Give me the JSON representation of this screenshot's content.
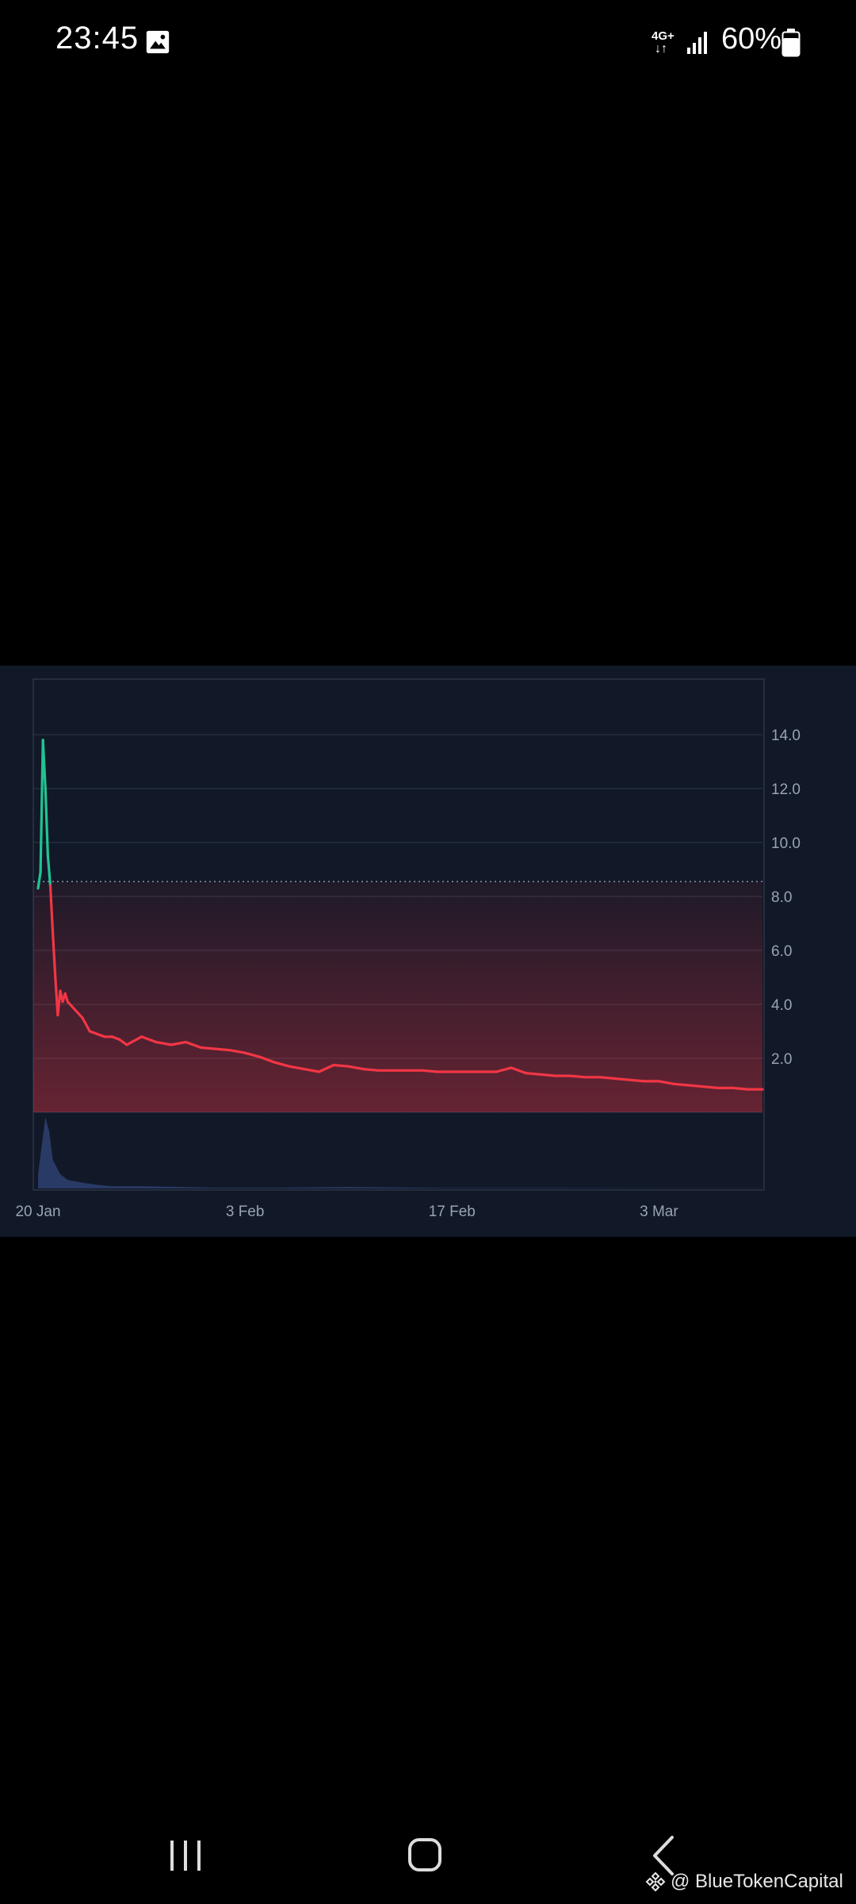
{
  "status_bar": {
    "time": "23:45",
    "network_type": "4G+",
    "battery_percent": "60%",
    "icons": [
      "gallery-icon",
      "signal-icon",
      "battery-icon"
    ]
  },
  "chart_data": {
    "type": "line",
    "x_ticks": [
      "20 Jan",
      "3 Feb",
      "17 Feb",
      "3 Mar"
    ],
    "y_ticks": [
      "14.0",
      "12.0",
      "10.0",
      "8.0",
      "6.0",
      "4.0",
      "2.0"
    ],
    "ylim": [
      0,
      16
    ],
    "reference_line": 8.55,
    "grid": true,
    "colors": {
      "up": "#22c391",
      "down": "#f23645",
      "background": "#111827",
      "grid": "#2a3142",
      "volume": "#2a3a66",
      "axis_text": "#9aa3b2"
    },
    "series": [
      {
        "color": "#f23645",
        "x": [
          "2025-01-20T00:00",
          "2025-01-20T04:00",
          "2025-01-20T08:00",
          "2025-01-20T12:00",
          "2025-01-20T16:00",
          "2025-01-20T20:00",
          "2025-01-21T00:00",
          "2025-01-21T04:00",
          "2025-01-21T08:00",
          "2025-01-21T12:00",
          "2025-01-21T16:00",
          "2025-01-21T20:00",
          "2025-01-22T00:00",
          "2025-01-22T12:00",
          "2025-01-23T00:00",
          "2025-01-23T12:00",
          "2025-01-24T00:00",
          "2025-01-24T12:00",
          "2025-01-25T00:00",
          "2025-01-25T12:00",
          "2025-01-26T00:00",
          "2025-01-27T00:00",
          "2025-01-28T00:00",
          "2025-01-29T00:00",
          "2025-01-30T00:00",
          "2025-01-31T00:00",
          "2025-02-01T00:00",
          "2025-02-02T00:00",
          "2025-02-03T00:00",
          "2025-02-04T00:00",
          "2025-02-05T00:00",
          "2025-02-06T00:00",
          "2025-02-07T00:00",
          "2025-02-08T00:00",
          "2025-02-09T00:00",
          "2025-02-10T00:00",
          "2025-02-11T00:00",
          "2025-02-12T00:00",
          "2025-02-13T00:00",
          "2025-02-14T00:00",
          "2025-02-15T00:00",
          "2025-02-16T00:00",
          "2025-02-17T00:00",
          "2025-02-18T00:00",
          "2025-02-19T00:00",
          "2025-02-20T00:00",
          "2025-02-21T00:00",
          "2025-02-22T00:00",
          "2025-02-23T00:00",
          "2025-02-24T00:00",
          "2025-02-25T00:00",
          "2025-02-26T00:00",
          "2025-02-27T00:00",
          "2025-02-28T00:00",
          "2025-03-01T00:00",
          "2025-03-02T00:00",
          "2025-03-03T00:00",
          "2025-03-04T00:00",
          "2025-03-05T00:00",
          "2025-03-06T00:00",
          "2025-03-07T00:00",
          "2025-03-08T00:00",
          "2025-03-09T00:00",
          "2025-03-10T00:00"
        ],
        "y": [
          8.3,
          8.9,
          13.8,
          12.0,
          9.5,
          8.4,
          6.6,
          5.0,
          3.6,
          4.5,
          4.1,
          4.4,
          4.1,
          3.8,
          3.5,
          3.0,
          2.9,
          2.8,
          2.8,
          2.7,
          2.5,
          2.8,
          2.6,
          2.5,
          2.6,
          2.4,
          2.35,
          2.3,
          2.2,
          2.05,
          1.85,
          1.7,
          1.6,
          1.5,
          1.75,
          1.7,
          1.6,
          1.55,
          1.55,
          1.55,
          1.55,
          1.5,
          1.5,
          1.5,
          1.5,
          1.5,
          1.65,
          1.45,
          1.4,
          1.35,
          1.35,
          1.3,
          1.3,
          1.25,
          1.2,
          1.15,
          1.15,
          1.05,
          1.0,
          0.95,
          0.9,
          0.9,
          0.85,
          0.85
        ]
      }
    ],
    "volume": {
      "x": [
        "2025-01-20T00:00",
        "2025-01-20T06:00",
        "2025-01-20T12:00",
        "2025-01-20T18:00",
        "2025-01-21T00:00",
        "2025-01-21T12:00",
        "2025-01-22T00:00",
        "2025-01-23T00:00",
        "2025-01-24T00:00",
        "2025-01-25T00:00",
        "2025-01-27T00:00",
        "2025-02-01T00:00",
        "2025-02-05T00:00",
        "2025-02-10T00:00",
        "2025-02-17T00:00",
        "2025-02-24T00:00",
        "2025-03-03T00:00",
        "2025-03-10T00:00"
      ],
      "y": [
        2,
        6,
        10,
        8,
        4,
        2,
        1.2,
        0.8,
        0.5,
        0.3,
        0.3,
        0.1,
        0.1,
        0.2,
        0.05,
        0.05,
        0.02,
        0.02
      ]
    }
  },
  "nav_bar": {
    "buttons": [
      "recent-apps",
      "home",
      "back"
    ]
  },
  "watermark": {
    "text": "@ BlueTokenCapital"
  }
}
